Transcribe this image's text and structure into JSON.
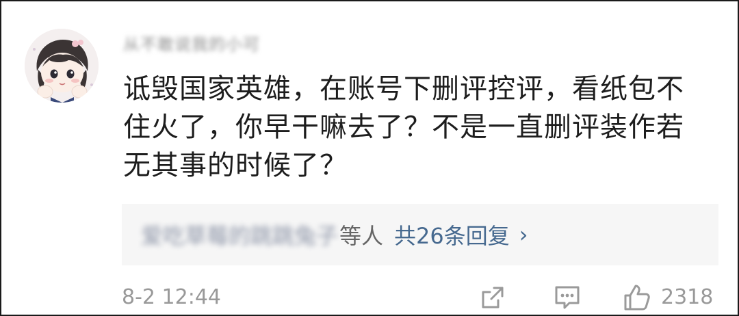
{
  "comment": {
    "username": "从不敢说我的小可",
    "text": "诋毁国家英雄，在账号下删评控评，看纸包不住火了，你早干嘛去了？不是一直删评装作若无其事的时候了？",
    "reply_preview": {
      "names": "爱吃草莓的跳跳兔子",
      "suffix": "等人",
      "count_label": "共26条回复",
      "chevron": "›"
    },
    "timestamp": "8-2 12:44",
    "likes": "2318"
  },
  "icons": {
    "share": "share-icon",
    "comment": "comment-icon",
    "like": "thumbs-up-icon",
    "avatar": "avatar-cartoon-girl"
  },
  "colors": {
    "text_primary": "#1d1d1d",
    "text_secondary": "#999999",
    "link_blue": "#46698f",
    "reply_bg": "#f6f6f6"
  }
}
